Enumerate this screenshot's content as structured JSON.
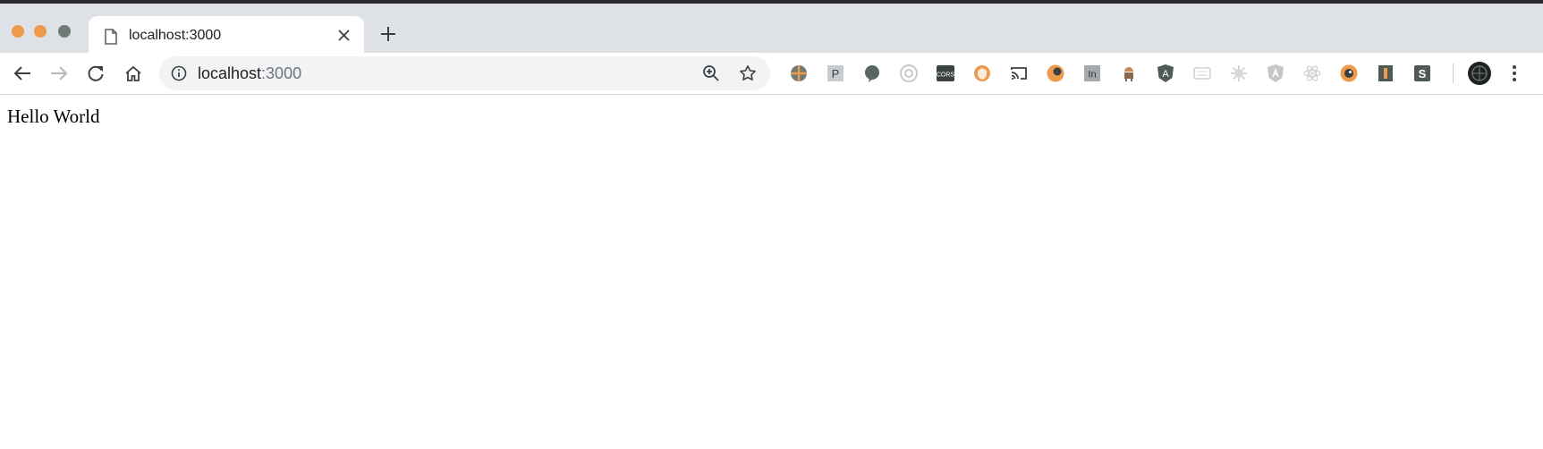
{
  "browser": {
    "tab": {
      "title": "localhost:3000",
      "icon": "document-icon"
    },
    "address_bar": {
      "host": "localhost",
      "port": ":3000"
    },
    "extensions": [
      "globe-extension-icon",
      "p-extension-icon",
      "speech-bubble-extension-icon",
      "target-extension-icon",
      "cors-extension-icon",
      "orange-shield-extension-icon",
      "cast-icon",
      "orange-circle-extension-icon",
      "in-extension-icon",
      "android-extension-icon",
      "angular-extension-icon",
      "keyboard-extension-icon",
      "gear-extension-icon",
      "angular-light-extension-icon",
      "react-extension-icon",
      "orange-eye-extension-icon",
      "battery-extension-icon",
      "s-extension-icon"
    ],
    "extension_labels": {
      "cors": "CORS",
      "p": "P",
      "in": "In",
      "angular": "A",
      "s": "S"
    }
  },
  "page": {
    "text": "Hello World"
  },
  "colors": {
    "tabstrip": "#dee1e6",
    "close_light": "#ee9a4d",
    "minimize_light": "#ee9a4d",
    "zoom_light": "#6f7c75",
    "omnibox": "#f1f3f4"
  }
}
